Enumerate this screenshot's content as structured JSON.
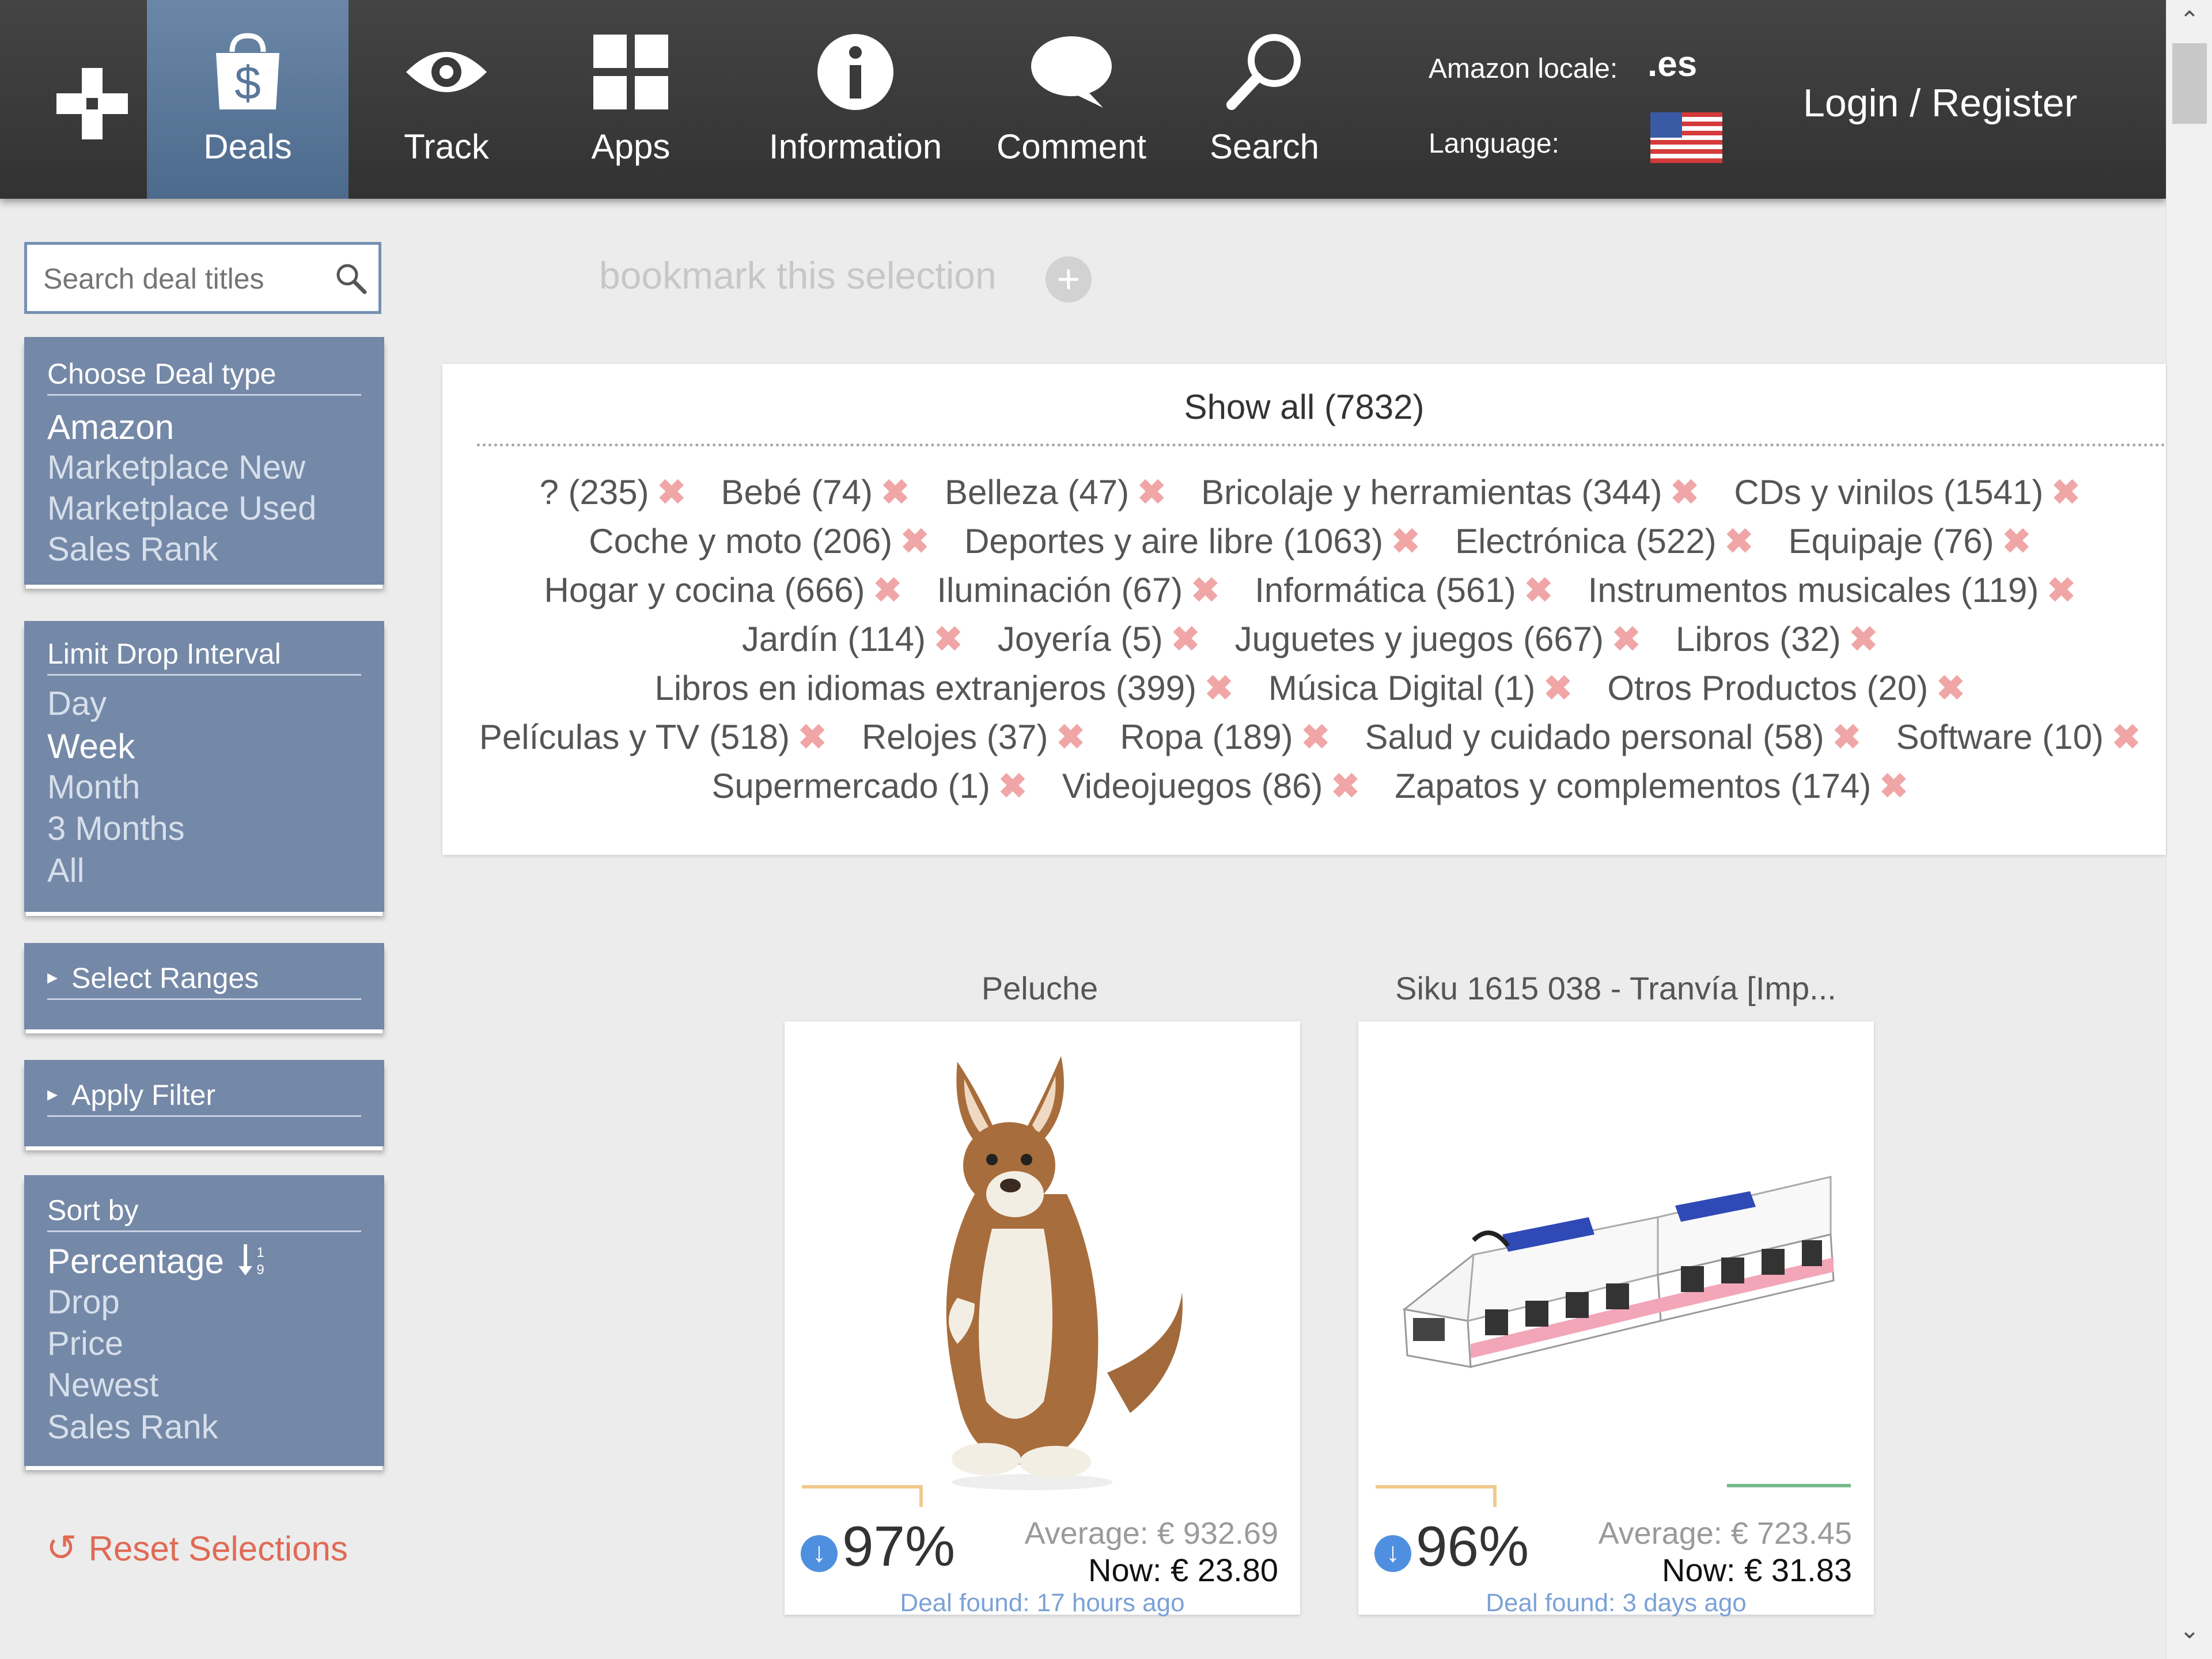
{
  "nav": {
    "items": [
      {
        "label": "Deals"
      },
      {
        "label": "Track"
      },
      {
        "label": "Apps"
      },
      {
        "label": "Information"
      },
      {
        "label": "Comment"
      },
      {
        "label": "Search"
      }
    ],
    "locale_label": "Amazon locale:",
    "locale_value": ".es",
    "language_label": "Language:",
    "login": "Login / Register"
  },
  "sidebar": {
    "search_placeholder": "Search deal titles",
    "deal_type": {
      "header": "Choose Deal type",
      "options": [
        "Amazon",
        "Marketplace New",
        "Marketplace Used",
        "Sales Rank"
      ],
      "selected": "Amazon"
    },
    "interval": {
      "header": "Limit Drop Interval",
      "options": [
        "Day",
        "Week",
        "Month",
        "3 Months",
        "All"
      ],
      "selected": "Week"
    },
    "select_ranges": "Select Ranges",
    "apply_filter": "Apply Filter",
    "sort": {
      "header": "Sort by",
      "options": [
        "Percentage",
        "Drop",
        "Price",
        "Newest",
        "Sales Rank"
      ],
      "selected": "Percentage"
    },
    "reset": "Reset Selections"
  },
  "main": {
    "bookmark": "bookmark this selection",
    "show_all": "Show all (7832)",
    "categories": [
      "? (235)",
      "Bebé (74)",
      "Belleza (47)",
      "Bricolaje y herramientas (344)",
      "CDs y vinilos (1541)",
      "Coche y moto (206)",
      "Deportes y aire libre (1063)",
      "Electrónica (522)",
      "Equipaje (76)",
      "Hogar y cocina (666)",
      "Iluminación (67)",
      "Informática (561)",
      "Instrumentos musicales (119)",
      "Jardín (114)",
      "Joyería (5)",
      "Juguetes y juegos (667)",
      "Libros (32)",
      "Libros en idiomas extranjeros (399)",
      "Música Digital (1)",
      "Otros Productos (20)",
      "Películas y TV (518)",
      "Relojes (37)",
      "Ropa (189)",
      "Salud y cuidado personal (58)",
      "Software (10)",
      "Supermercado (1)",
      "Videojuegos (86)",
      "Zapatos y complementos (174)"
    ],
    "deals": [
      {
        "title": "Peluche",
        "percent": "97%",
        "average": "Average: € 932.69",
        "now": "Now: € 23.80",
        "found": "Deal found: 17 hours ago",
        "image": "plush-kangaroo"
      },
      {
        "title": "Siku 1615 038 - Tranvía [Imp...",
        "percent": "96%",
        "average": "Average: € 723.45",
        "now": "Now: € 31.83",
        "found": "Deal found: 3 days ago",
        "image": "toy-tram"
      }
    ]
  },
  "colors": {
    "topbar": "#3a3a3a",
    "active_tab": "#5a779a",
    "panel": "#7488a7",
    "reset": "#e06a55",
    "remove_x": "#f0a6a6"
  }
}
